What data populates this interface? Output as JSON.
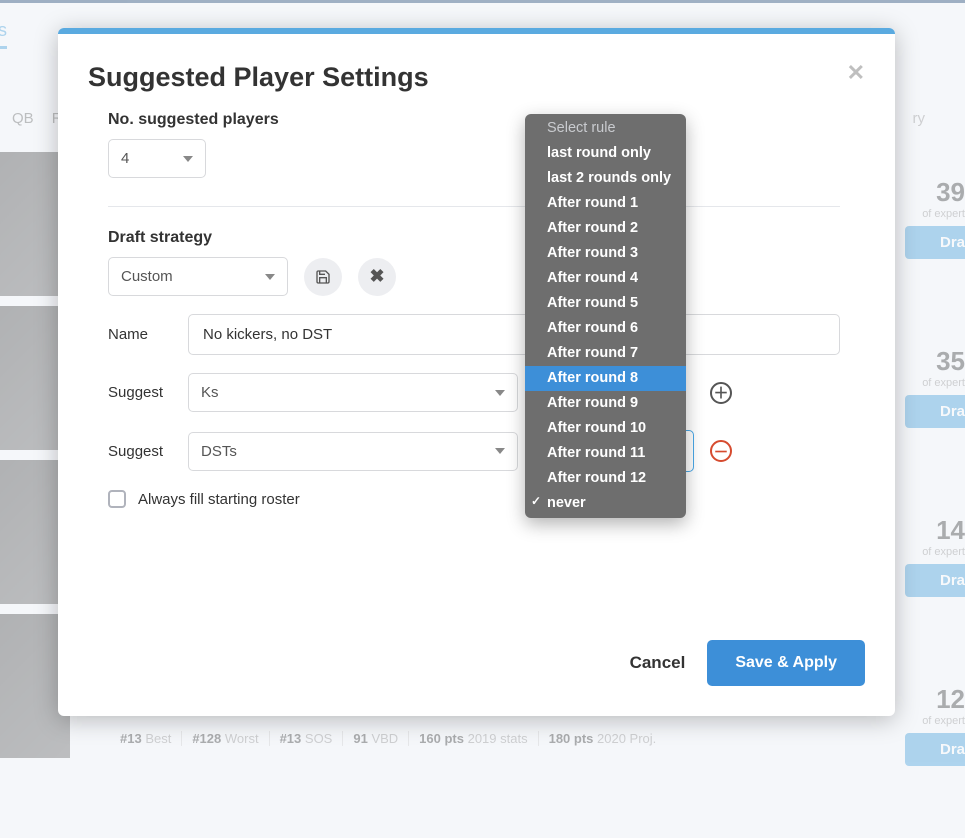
{
  "background": {
    "tab": "stions",
    "positions": [
      "QB",
      "R"
    ],
    "ry": "ry",
    "cards": [
      {
        "num": "39",
        "sub": "of expert",
        "btn": "Dra"
      },
      {
        "num": "35",
        "sub": "of expert",
        "btn": "Dra"
      },
      {
        "num": "14",
        "sub": "of expert",
        "btn": "Dra"
      },
      {
        "num": "12",
        "sub": "of expert",
        "btn": "Dra"
      }
    ],
    "stats": [
      {
        "b": "#13",
        "t": "Best"
      },
      {
        "b": "#128",
        "t": "Worst"
      },
      {
        "b": "#13",
        "t": "SOS"
      },
      {
        "b": "91",
        "t": "VBD"
      },
      {
        "b": "160 pts",
        "t": "2019 stats"
      },
      {
        "b": "180 pts",
        "t": "2020 Proj."
      }
    ]
  },
  "modal": {
    "title": "Suggested Player Settings",
    "num_players": {
      "label": "No. suggested players",
      "value": "4"
    },
    "strategy": {
      "label": "Draft strategy",
      "value": "Custom"
    },
    "rows": {
      "name": {
        "label": "Name",
        "value": "No kickers, no DST"
      },
      "suggest1": {
        "label": "Suggest",
        "value": "Ks"
      },
      "suggest2": {
        "label": "Suggest",
        "value": "DSTs"
      }
    },
    "checkbox": "Always fill starting roster",
    "footer": {
      "cancel": "Cancel",
      "apply": "Save & Apply"
    }
  },
  "dropdown": {
    "header": "Select rule",
    "items": [
      "last round only",
      "last 2 rounds only",
      "After round 1",
      "After round 2",
      "After round 3",
      "After round 4",
      "After round 5",
      "After round 6",
      "After round 7",
      "After round 8",
      "After round 9",
      "After round 10",
      "After round 11",
      "After round 12",
      "never"
    ],
    "highlighted": "After round 8",
    "checked": "never"
  }
}
